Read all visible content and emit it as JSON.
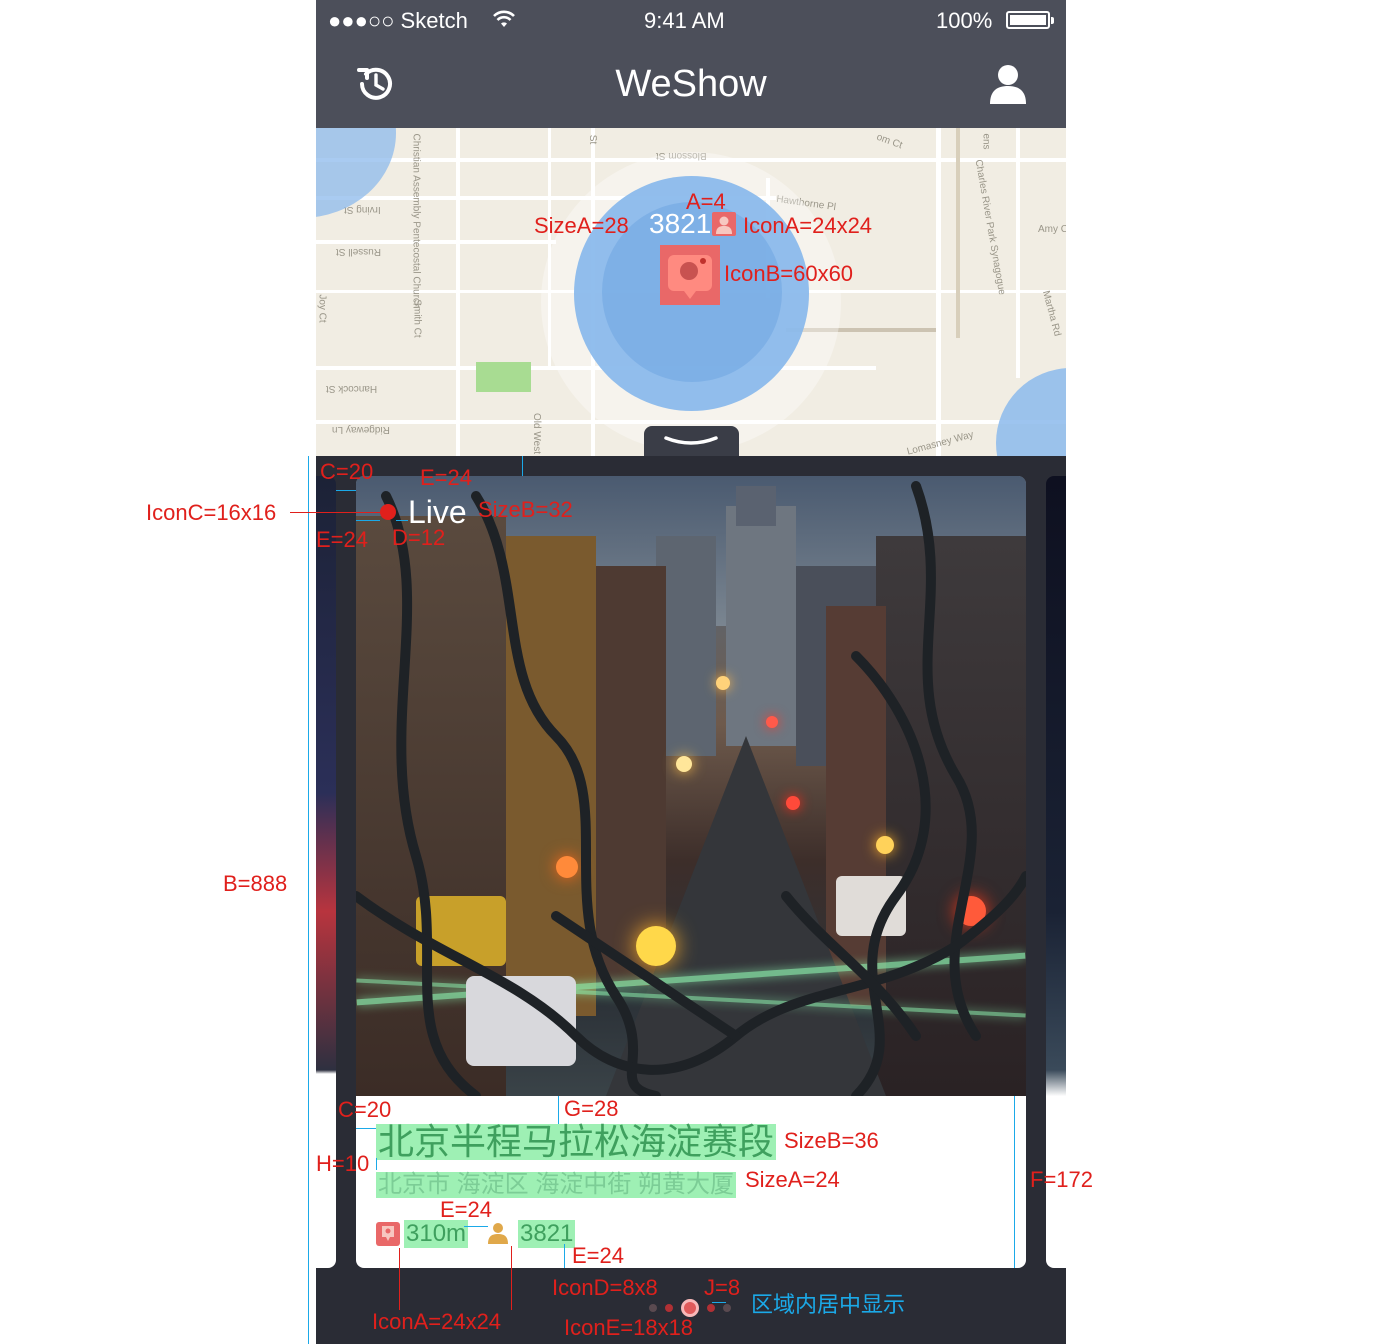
{
  "status_bar": {
    "carrier": "●●●○○ Sketch",
    "time": "9:41 AM",
    "battery": "100%"
  },
  "nav": {
    "title": "WeShow"
  },
  "map": {
    "streets": [
      "Blossom St",
      "Irving St",
      "Russell St",
      "Smith Ct",
      "Joy Ct",
      "Hancock St",
      "Ridgeway Ln",
      "Old West",
      "Hawthorne Pl",
      "Charles River Park Synagogue",
      "Amy Ct",
      "Martha Rd",
      "Lomasney Way",
      "Christian Assembly Pentecostal Church",
      "St",
      "om Ct",
      "ens"
    ],
    "cluster_count": "3821"
  },
  "card": {
    "live_label": "Live",
    "title": "北京半程马拉松海淀赛段",
    "address": "北京市 海淀区 海淀中街 朔黄大厦",
    "distance": "310m",
    "viewers": "3821"
  },
  "annotations": {
    "a": "A=4",
    "size_a_map": "SizeA=28",
    "icon_a_map": "IconA=24x24",
    "icon_b": "IconB=60x60",
    "c_top": "C=20",
    "e_top_right": "E=24",
    "icon_c": "IconC=16x16",
    "size_b_live": "SizeB=32",
    "e_left": "E=24",
    "d": "D=12",
    "b": "B=888",
    "c_bottom": "C=20",
    "g": "G=28",
    "size_b_title": "SizeB=36",
    "h": "H=10",
    "size_a_address": "SizeA=24",
    "f": "F=172",
    "e_mid": "E=24",
    "e_bottom": "E=24",
    "icon_d": "IconD=8x8",
    "j": "J=8",
    "icon_a_bottom": "IconA=24x24",
    "icon_e": "IconE=18x18",
    "center_note": "区域内居中显示"
  },
  "colors": {
    "nav_bg": "#4c4f5a",
    "annotation": "#e0201c",
    "guide": "#1ba9e8",
    "highlight": "#9ef0b4",
    "pin": "#e96868",
    "map_bg": "#f1ede3"
  },
  "icons": {
    "history": "history-icon",
    "user": "user-icon",
    "pin": "pin-icon",
    "person": "person-icon",
    "wifi": "wifi-icon",
    "battery": "battery-icon"
  }
}
